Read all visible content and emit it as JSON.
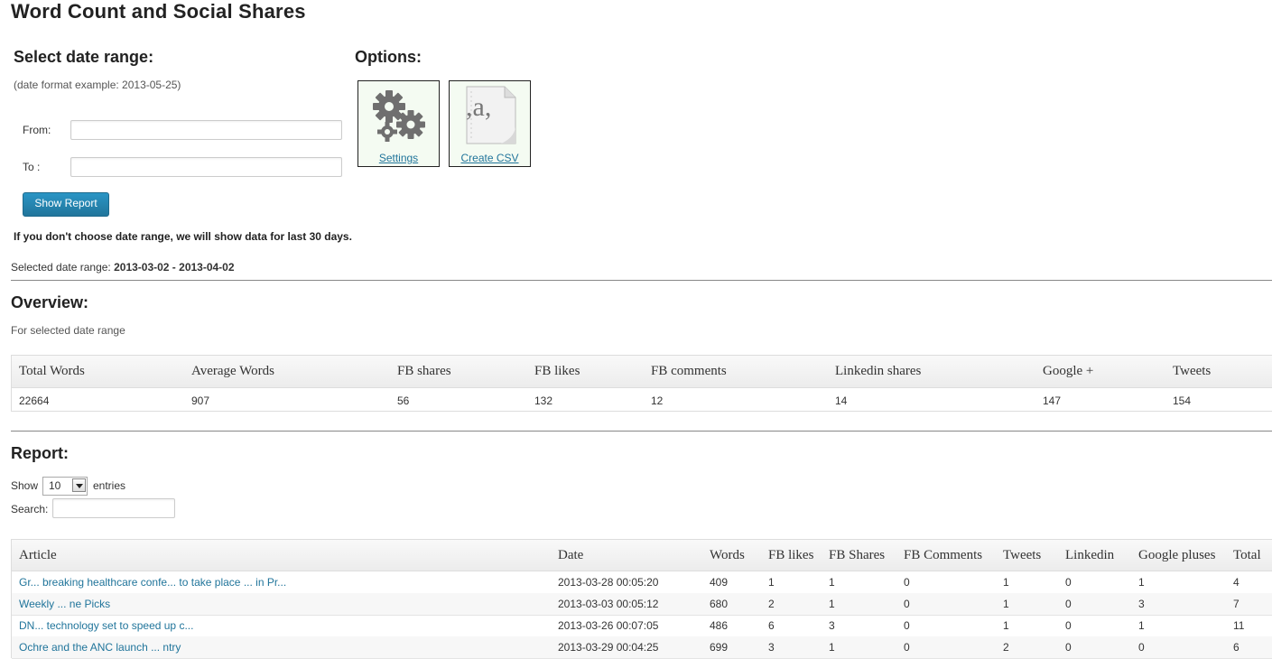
{
  "page": {
    "title": "Word Count and Social Shares"
  },
  "date_range": {
    "heading": "Select date range:",
    "format_hint": "(date format example: 2013-05-25)",
    "from_label": "From:",
    "from_value": "",
    "to_label": "To :",
    "to_value": "",
    "show_button": "Show Report",
    "note": "If you don't choose date range, we will show data for last 30 days.",
    "selected_label": "Selected date range:",
    "selected_value": "2013-03-02 - 2013-04-02"
  },
  "options": {
    "heading": "Options:",
    "settings_label": "Settings",
    "settings_icon": "gears-icon",
    "csv_label": "Create CSV",
    "csv_icon": "csv-file-icon",
    "csv_glyph": ",a,"
  },
  "overview": {
    "heading": "Overview:",
    "subtitle": "For selected date range",
    "columns": [
      "Total Words",
      "Average Words",
      "FB shares",
      "FB likes",
      "FB comments",
      "Linkedin shares",
      "Google +",
      "Tweets"
    ],
    "values": [
      "22664",
      "907",
      "56",
      "132",
      "12",
      "14",
      "147",
      "154"
    ]
  },
  "report": {
    "heading": "Report:",
    "show_label": "Show",
    "entries_value": "10",
    "entries_label": "entries",
    "search_label": "Search:",
    "search_value": "",
    "columns": [
      "Article",
      "Date",
      "Words",
      "FB likes",
      "FB Shares",
      "FB Comments",
      "Tweets",
      "Linkedin",
      "Google pluses",
      "Total"
    ],
    "rows": [
      [
        "Gr... breaking healthcare confe... to take place ... in Pr...",
        "2013-03-28 00:05:20",
        "409",
        "1",
        "1",
        "0",
        "1",
        "0",
        "1",
        "4"
      ],
      [
        "Weekly ... ne Picks",
        "2013-03-03 00:05:12",
        "680",
        "2",
        "1",
        "0",
        "1",
        "0",
        "3",
        "7"
      ],
      [
        "DN... technology set to speed up c...",
        "2013-03-26 00:07:05",
        "486",
        "6",
        "3",
        "0",
        "1",
        "0",
        "1",
        "11"
      ],
      [
        "Ochre and the ANC launch ... ntry",
        "2013-03-29 00:04:25",
        "699",
        "3",
        "1",
        "0",
        "2",
        "0",
        "0",
        "6"
      ]
    ]
  },
  "colors": {
    "link": "#21759b",
    "button": "#21759b",
    "option_bg": "#f4fbf2"
  }
}
